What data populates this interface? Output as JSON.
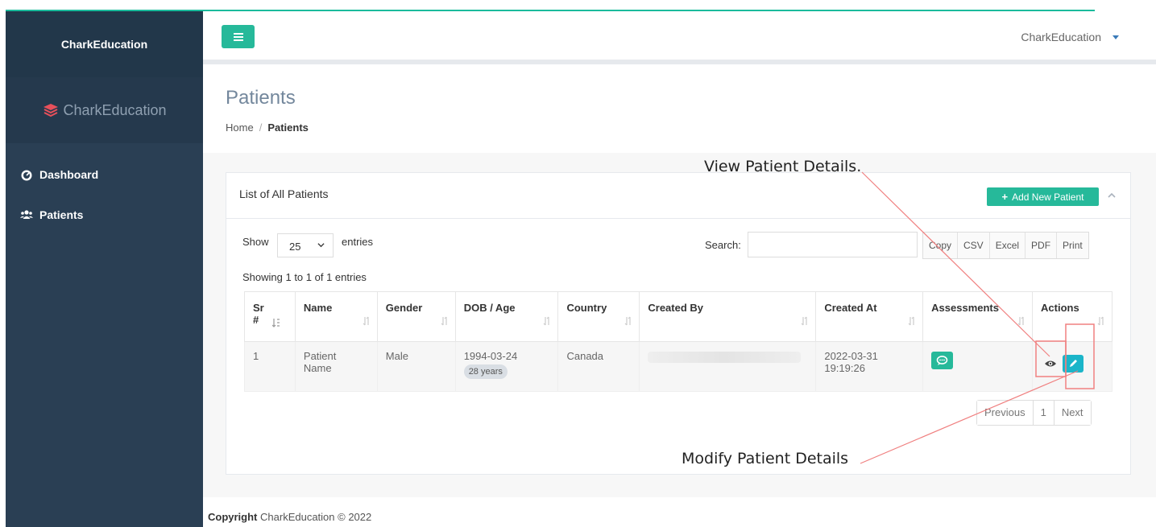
{
  "sidebar": {
    "brand_title": "CharkEducation",
    "logo_text": "CharkEducation",
    "items": [
      {
        "label": "Dashboard",
        "icon": "tachometer-icon"
      },
      {
        "label": "Patients",
        "icon": "users-icon"
      }
    ]
  },
  "topnav": {
    "user_name": "CharkEducation"
  },
  "page": {
    "title": "Patients",
    "breadcrumb_home": "Home",
    "breadcrumb_sep": "/",
    "breadcrumb_current": "Patients"
  },
  "panel": {
    "title": "List of All Patients",
    "add_button_label": "Add New Patient",
    "show_label": "Show",
    "entries_value": "25",
    "entries_label": "entries",
    "search_label": "Search:",
    "search_value": "",
    "export_buttons": [
      "Copy",
      "CSV",
      "Excel",
      "PDF",
      "Print"
    ],
    "info_text": "Showing 1 to 1 of 1 entries"
  },
  "table": {
    "headers": {
      "sr_line1": "Sr",
      "sr_line2": "#",
      "name": "Name",
      "gender": "Gender",
      "dob": "DOB / Age",
      "country": "Country",
      "created_by": "Created By",
      "created_at": "Created At",
      "assessments": "Assessments",
      "actions": "Actions"
    },
    "rows": [
      {
        "sr": "1",
        "name_line1": "Patient",
        "name_line2": "Name",
        "gender": "Male",
        "dob": "1994-03-24",
        "age": "28 years",
        "country": "Canada",
        "created_at_date": "2022-03-31",
        "created_at_time": "19:19:26"
      }
    ]
  },
  "pagination": {
    "previous": "Previous",
    "page": "1",
    "next": "Next"
  },
  "footer": {
    "copyright_bold": "Copyright",
    "copyright_rest": "CharkEducation © 2022"
  },
  "annotations": {
    "view_label": "View Patient Details.",
    "modify_label": "Modify Patient Details"
  },
  "colors": {
    "sidebar_bg": "#2a3f54",
    "accent_green": "#26b99a",
    "edit_cyan": "#1bb5c9",
    "annotation_red": "#f08080"
  }
}
